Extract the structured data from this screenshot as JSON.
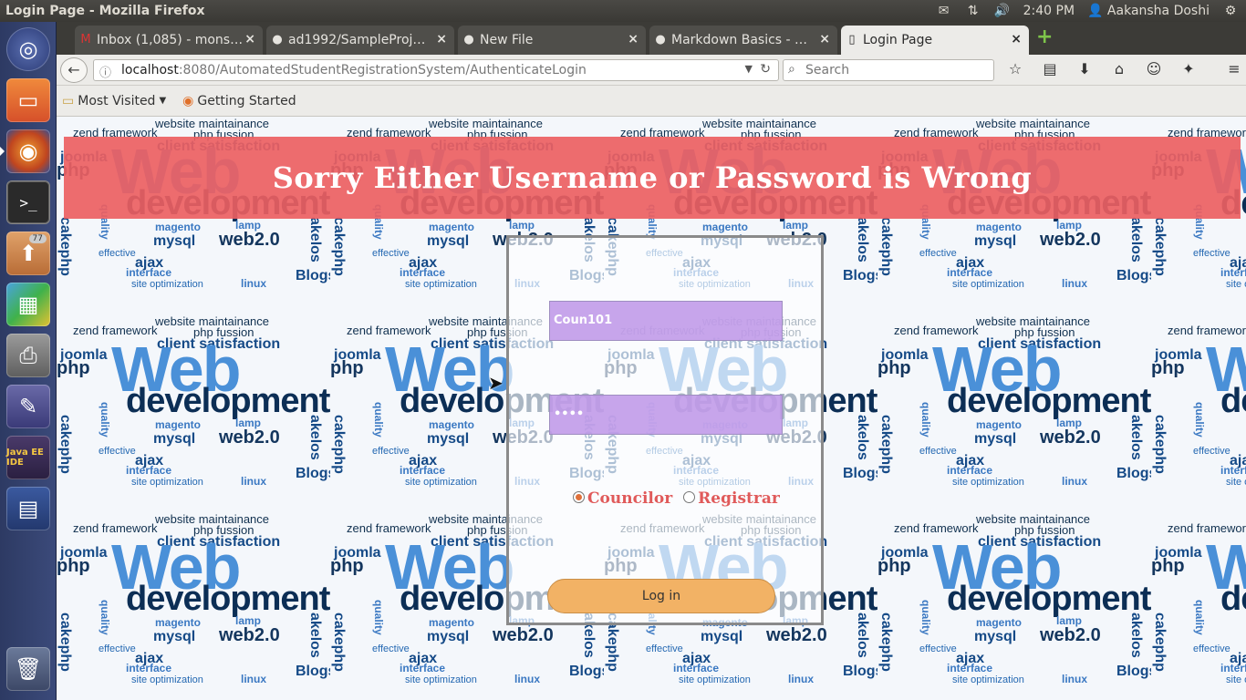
{
  "system": {
    "window_title": "Login Page - Mozilla Firefox",
    "time": "2:40 PM",
    "user": "Aakansha Doshi"
  },
  "launcher": {
    "items": [
      {
        "name": "dash-home",
        "icon": "ubuntu-logo-icon"
      },
      {
        "name": "files",
        "icon": "folder-icon"
      },
      {
        "name": "firefox",
        "icon": "firefox-icon"
      },
      {
        "name": "terminal",
        "icon": "terminal-icon"
      },
      {
        "name": "software-updater",
        "icon": "updater-icon",
        "badge": "77"
      },
      {
        "name": "app-blocks",
        "icon": "blocks-icon"
      },
      {
        "name": "printer",
        "icon": "printer-icon"
      },
      {
        "name": "emacs",
        "icon": "emacs-icon"
      },
      {
        "name": "java-ee-ide",
        "icon": "java-ee-ide-icon",
        "label": "Java EE IDE"
      },
      {
        "name": "workspace-switcher",
        "icon": "workspaces-icon"
      },
      {
        "name": "trash",
        "icon": "trash-icon"
      }
    ]
  },
  "tabs": [
    {
      "title": "Inbox (1,085) - mons…",
      "icon": "gmail-icon",
      "active": false
    },
    {
      "title": "ad1992/SampleProj…",
      "icon": "github-icon",
      "active": false
    },
    {
      "title": "New File",
      "icon": "github-icon",
      "active": false
    },
    {
      "title": "Markdown Basics - …",
      "icon": "github-icon",
      "active": false
    },
    {
      "title": "Login Page",
      "icon": "page-icon",
      "active": true
    }
  ],
  "navbar": {
    "url_host": "localhost",
    "url_rest": ":8080/AutomatedStudentRegistrationSystem/AuthenticateLogin",
    "search_placeholder": "Search"
  },
  "bookmarks": {
    "most_visited": "Most Visited",
    "getting_started": "Getting Started"
  },
  "page": {
    "error_message": "Sorry Either Username or Password is Wrong",
    "username_value": "Coun101",
    "password_value": "••••",
    "roles": [
      {
        "label": "Councilor",
        "checked": true
      },
      {
        "label": "Registrar",
        "checked": false
      }
    ],
    "login_button": "Log in"
  },
  "colors": {
    "banner": "#ec5f62",
    "field": "#bf99e8",
    "button": "#f2b265",
    "role_text": "#e05a5a"
  }
}
